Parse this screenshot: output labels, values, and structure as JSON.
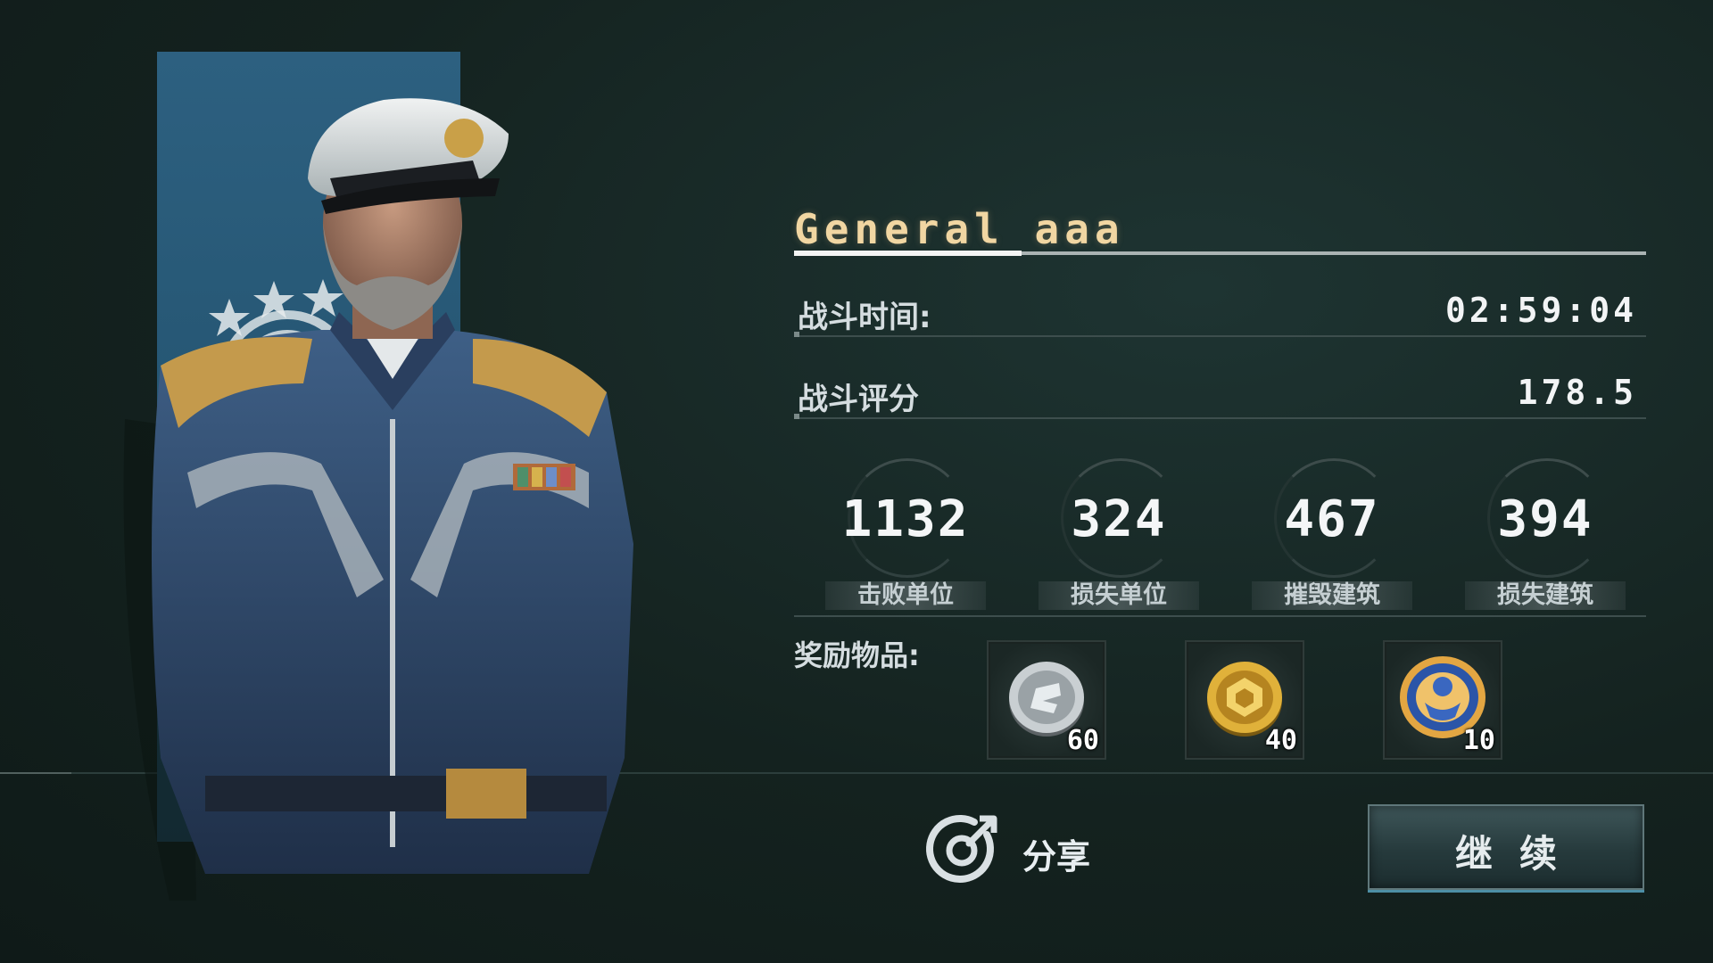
{
  "general": {
    "name": "General aaa"
  },
  "stats": {
    "battle_time_label": "战斗时间:",
    "battle_time_value": "02:59:04",
    "battle_score_label": "战斗评分",
    "battle_score_value": "178.5"
  },
  "counters": [
    {
      "value": "1132",
      "label": "击败单位"
    },
    {
      "value": "324",
      "label": "损失单位"
    },
    {
      "value": "467",
      "label": "摧毁建筑"
    },
    {
      "value": "394",
      "label": "损失建筑"
    }
  ],
  "rewards": {
    "label": "奖励物品:",
    "items": [
      {
        "icon": "silver-coin-icon",
        "count": "60"
      },
      {
        "icon": "gold-coin-icon",
        "count": "40"
      },
      {
        "icon": "medal-icon",
        "count": "10"
      }
    ]
  },
  "actions": {
    "share_label": "分享",
    "continue_label": "继续"
  },
  "colors": {
    "name": "#f1d6a2",
    "banner": "#2d6080",
    "background": "#14221f",
    "button_glow": "#4d8fa6"
  }
}
